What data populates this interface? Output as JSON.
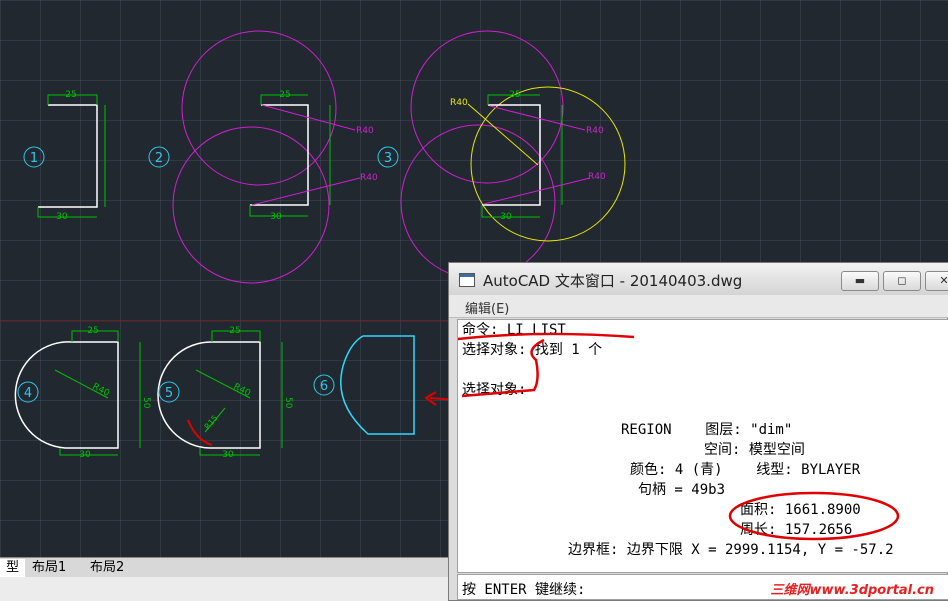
{
  "drawing": {
    "labels": {
      "circle_1": "1",
      "circle_2": "2",
      "circle_3": "3",
      "circle_4": "4",
      "circle_5": "5",
      "circle_6": "6",
      "dim_25": "25",
      "dim_30": "30",
      "dim_50": "50",
      "r40": "R40",
      "r15": "R15"
    },
    "colors": {
      "background": "#212830",
      "dimension": "#00c000",
      "geometry": "#ffffff",
      "circle_magenta": "#d020d0",
      "circle_yellow": "#e8e800",
      "label_cyan": "#30c8e8",
      "region": "#30d8ff",
      "annotation": "#e00000"
    }
  },
  "layout_tabs": {
    "model": "型",
    "layout1": "布局1",
    "layout2": "布局2"
  },
  "text_window": {
    "title": "AutoCAD 文本窗口 - 20140403.dwg",
    "menu_edit": "编辑(E)",
    "buttons": {
      "minimize": "▬",
      "maximize": "◻",
      "close": "✕"
    },
    "lines": {
      "l1": "命令: LI LIST",
      "l2": "选择对象: 找到 1 个",
      "l3": "选择对象:",
      "l4": "REGION    图层: \"dim\"",
      "l5": "空间: 模型空间",
      "l6": "颜色: 4 (青)    线型: BYLAYER",
      "l7": "句柄 = 49b3",
      "l8": "面积: 1661.8900",
      "l9": "周长: 157.2656",
      "l10": "边界框: 边界下限 X = 2999.1154, Y = -57.2"
    },
    "prompt": "按 ENTER 键继续:",
    "watermark": "三维网www.3dportal.cn"
  }
}
